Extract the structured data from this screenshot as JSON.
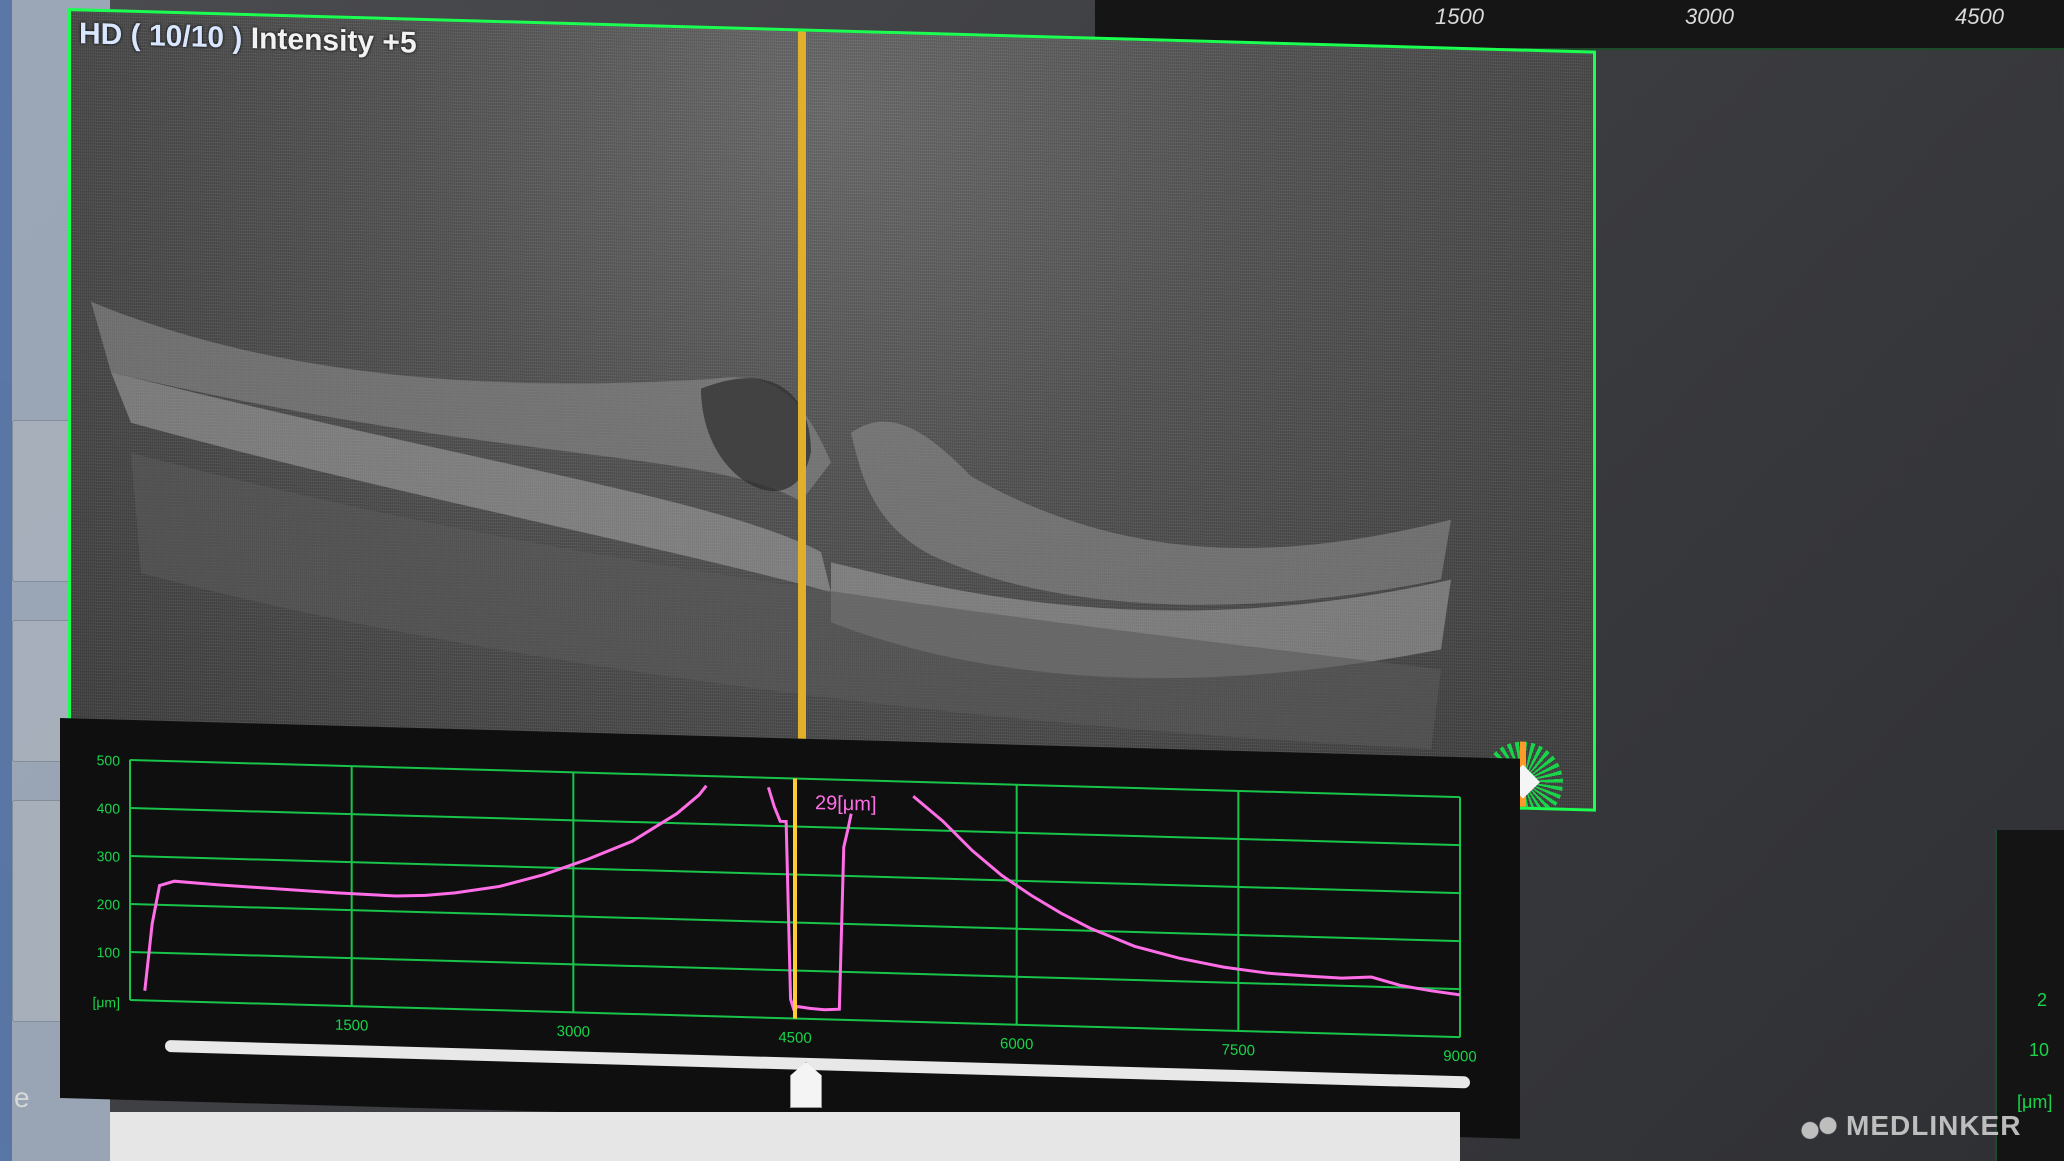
{
  "scan": {
    "mode_label": "HD ( 10/10 )",
    "intensity_label": "Intensity +5"
  },
  "top_ruler": {
    "ticks": [
      "1500",
      "3000",
      "4500"
    ]
  },
  "chart_data": {
    "type": "line",
    "title": "",
    "readout": "29[μm]",
    "ylabel": "[μm]",
    "y_ticks": [
      "500",
      "400",
      "300",
      "200",
      "100"
    ],
    "x_ticks": [
      "1500",
      "3000",
      "4500",
      "6000",
      "7500",
      "9000"
    ],
    "xlim": [
      0,
      9000
    ],
    "ylim": [
      0,
      500
    ],
    "cursor_x": 4500,
    "grid": true,
    "series": [
      {
        "color": "#ff6ee6",
        "segments": [
          {
            "x": [
              100,
              150,
              200,
              300,
              600,
              1000,
              1400,
              1800,
              2000,
              2200,
              2500,
              2800,
              3100,
              3400,
              3700,
              3850,
              3900
            ],
            "y": [
              20,
              160,
              240,
              250,
              245,
              240,
              235,
              232,
              235,
              242,
              258,
              285,
              320,
              360,
              420,
              460,
              480
            ]
          },
          {
            "x": [
              4320,
              4360,
              4400,
              4440,
              4470,
              4490,
              4520,
              4600,
              4700,
              4800,
              4830,
              4860,
              4880
            ],
            "y": [
              480,
              440,
              410,
              410,
              40,
              20,
              25,
              22,
              20,
              22,
              360,
              400,
              430
            ]
          },
          {
            "x": [
              5300,
              5500,
              5700,
              5900,
              6100,
              6300,
              6500,
              6800,
              7100,
              7400,
              7700,
              8000,
              8200,
              8400,
              8600,
              8800,
              9000
            ],
            "y": [
              470,
              420,
              360,
              310,
              270,
              235,
              205,
              170,
              148,
              132,
              122,
              118,
              116,
              120,
              104,
              95,
              88
            ]
          }
        ]
      }
    ]
  },
  "left_rail": {
    "label": "e"
  },
  "right_panel": {
    "ticks": [
      "2",
      "10",
      "[μm]"
    ]
  },
  "watermark": {
    "text": "MEDLINKER"
  }
}
